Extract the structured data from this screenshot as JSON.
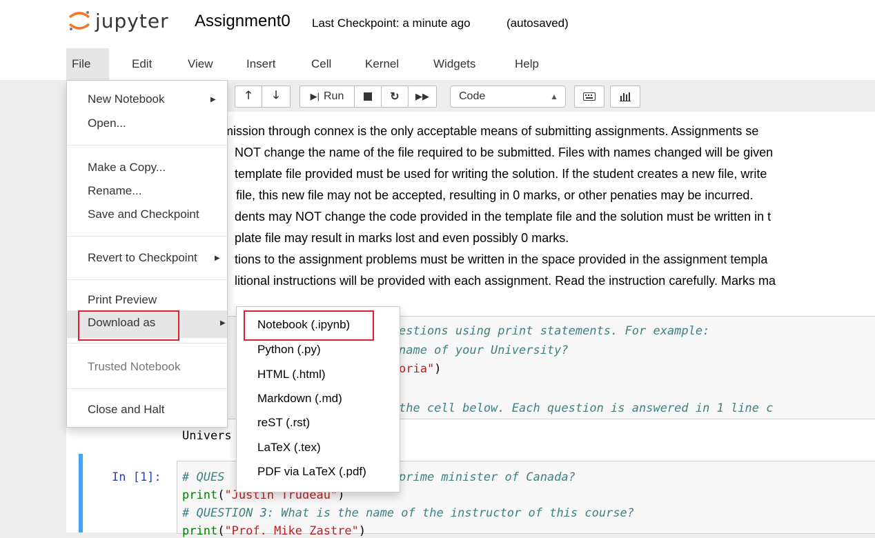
{
  "header": {
    "logo_text": "jupyter",
    "notebook_name": "Assignment0",
    "checkpoint": "Last Checkpoint: a minute ago",
    "autosave": "(autosaved)"
  },
  "menubar": [
    "File",
    "Edit",
    "View",
    "Insert",
    "Cell",
    "Kernel",
    "Widgets",
    "Help"
  ],
  "toolbar": {
    "run_label": "Run",
    "cell_type": "Code"
  },
  "file_menu": {
    "new_notebook": "New Notebook",
    "open": "Open...",
    "make_copy": "Make a Copy...",
    "rename": "Rename...",
    "save_checkpoint": "Save and Checkpoint",
    "revert": "Revert to Checkpoint",
    "print_preview": "Print Preview",
    "download_as": "Download as",
    "trusted": "Trusted Notebook",
    "close_halt": "Close and Halt"
  },
  "download_menu": [
    "Notebook (.ipynb)",
    "Python (.py)",
    "HTML (.html)",
    "Markdown (.md)",
    "reST (.rst)",
    "LaTeX (.tex)",
    "PDF via LaTeX (.pdf)"
  ],
  "markdown_lines": [
    "mission through connex is the only acceptable means of submitting assignments. Assignments se",
    "NOT change the name of the file required to be submitted. Files with names changed will be given",
    "template file provided must be used for writing the solution. If the student creates a new file, write",
    "file, this new file may not be accepted, resulting in 0 marks, or other penaties may be incurred.",
    "dents may NOT change the code provided in the template file and the solution must be written in t",
    "plate file may result in marks lost and even possibly 0 marks.",
    "tions to the assignment problems must be written in the space provided in the assignment templa",
    "litional instructions will be provided with each assignment. Read the instruction carefully. Marks ma"
  ],
  "code_cell_1": {
    "line1": "estions using print statements. For example:",
    "line2": "name of your University?",
    "line3_str": "oria\"",
    "line3_end": ")",
    "line4": "the cell below. Each question is answered in 1 line c"
  },
  "output_1": "Univers",
  "code_cell_2": {
    "prompt": "In [1]:",
    "line1a": "# QUES",
    "line1b": "prime minister of Canada?",
    "line2_fn": "print",
    "line2_str": "\"Justin Trudeau\"",
    "line3": "# QUESTION 3: What is the name of the instructor of this course?",
    "line4_fn": "print",
    "line4_str": "\"Prof. Mike Zastre\""
  },
  "colors": {
    "comment": "#408080",
    "string": "#ba2121",
    "builtin": "#008000",
    "highlight_box": "#e02020",
    "selected_cell": "#42a5f5"
  }
}
